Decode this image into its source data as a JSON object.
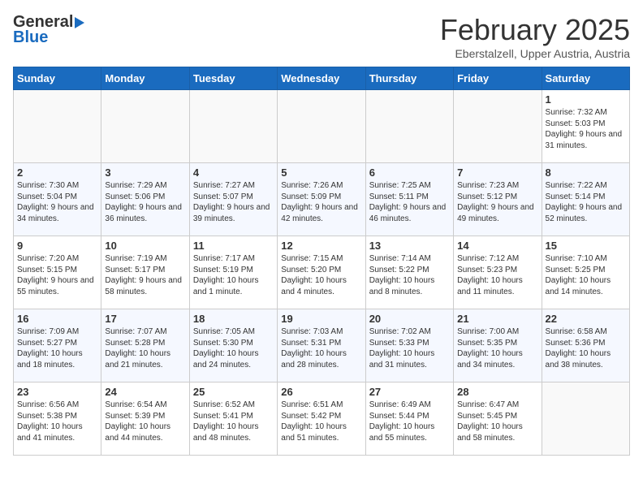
{
  "header": {
    "logo_line1_general": "General",
    "logo_line1_blue": "Blue",
    "title": "February 2025",
    "location": "Eberstalzell, Upper Austria, Austria"
  },
  "days_of_week": [
    "Sunday",
    "Monday",
    "Tuesday",
    "Wednesday",
    "Thursday",
    "Friday",
    "Saturday"
  ],
  "weeks": [
    [
      {
        "day": "",
        "info": ""
      },
      {
        "day": "",
        "info": ""
      },
      {
        "day": "",
        "info": ""
      },
      {
        "day": "",
        "info": ""
      },
      {
        "day": "",
        "info": ""
      },
      {
        "day": "",
        "info": ""
      },
      {
        "day": "1",
        "info": "Sunrise: 7:32 AM\nSunset: 5:03 PM\nDaylight: 9 hours and 31 minutes."
      }
    ],
    [
      {
        "day": "2",
        "info": "Sunrise: 7:30 AM\nSunset: 5:04 PM\nDaylight: 9 hours and 34 minutes."
      },
      {
        "day": "3",
        "info": "Sunrise: 7:29 AM\nSunset: 5:06 PM\nDaylight: 9 hours and 36 minutes."
      },
      {
        "day": "4",
        "info": "Sunrise: 7:27 AM\nSunset: 5:07 PM\nDaylight: 9 hours and 39 minutes."
      },
      {
        "day": "5",
        "info": "Sunrise: 7:26 AM\nSunset: 5:09 PM\nDaylight: 9 hours and 42 minutes."
      },
      {
        "day": "6",
        "info": "Sunrise: 7:25 AM\nSunset: 5:11 PM\nDaylight: 9 hours and 46 minutes."
      },
      {
        "day": "7",
        "info": "Sunrise: 7:23 AM\nSunset: 5:12 PM\nDaylight: 9 hours and 49 minutes."
      },
      {
        "day": "8",
        "info": "Sunrise: 7:22 AM\nSunset: 5:14 PM\nDaylight: 9 hours and 52 minutes."
      }
    ],
    [
      {
        "day": "9",
        "info": "Sunrise: 7:20 AM\nSunset: 5:15 PM\nDaylight: 9 hours and 55 minutes."
      },
      {
        "day": "10",
        "info": "Sunrise: 7:19 AM\nSunset: 5:17 PM\nDaylight: 9 hours and 58 minutes."
      },
      {
        "day": "11",
        "info": "Sunrise: 7:17 AM\nSunset: 5:19 PM\nDaylight: 10 hours and 1 minute."
      },
      {
        "day": "12",
        "info": "Sunrise: 7:15 AM\nSunset: 5:20 PM\nDaylight: 10 hours and 4 minutes."
      },
      {
        "day": "13",
        "info": "Sunrise: 7:14 AM\nSunset: 5:22 PM\nDaylight: 10 hours and 8 minutes."
      },
      {
        "day": "14",
        "info": "Sunrise: 7:12 AM\nSunset: 5:23 PM\nDaylight: 10 hours and 11 minutes."
      },
      {
        "day": "15",
        "info": "Sunrise: 7:10 AM\nSunset: 5:25 PM\nDaylight: 10 hours and 14 minutes."
      }
    ],
    [
      {
        "day": "16",
        "info": "Sunrise: 7:09 AM\nSunset: 5:27 PM\nDaylight: 10 hours and 18 minutes."
      },
      {
        "day": "17",
        "info": "Sunrise: 7:07 AM\nSunset: 5:28 PM\nDaylight: 10 hours and 21 minutes."
      },
      {
        "day": "18",
        "info": "Sunrise: 7:05 AM\nSunset: 5:30 PM\nDaylight: 10 hours and 24 minutes."
      },
      {
        "day": "19",
        "info": "Sunrise: 7:03 AM\nSunset: 5:31 PM\nDaylight: 10 hours and 28 minutes."
      },
      {
        "day": "20",
        "info": "Sunrise: 7:02 AM\nSunset: 5:33 PM\nDaylight: 10 hours and 31 minutes."
      },
      {
        "day": "21",
        "info": "Sunrise: 7:00 AM\nSunset: 5:35 PM\nDaylight: 10 hours and 34 minutes."
      },
      {
        "day": "22",
        "info": "Sunrise: 6:58 AM\nSunset: 5:36 PM\nDaylight: 10 hours and 38 minutes."
      }
    ],
    [
      {
        "day": "23",
        "info": "Sunrise: 6:56 AM\nSunset: 5:38 PM\nDaylight: 10 hours and 41 minutes."
      },
      {
        "day": "24",
        "info": "Sunrise: 6:54 AM\nSunset: 5:39 PM\nDaylight: 10 hours and 44 minutes."
      },
      {
        "day": "25",
        "info": "Sunrise: 6:52 AM\nSunset: 5:41 PM\nDaylight: 10 hours and 48 minutes."
      },
      {
        "day": "26",
        "info": "Sunrise: 6:51 AM\nSunset: 5:42 PM\nDaylight: 10 hours and 51 minutes."
      },
      {
        "day": "27",
        "info": "Sunrise: 6:49 AM\nSunset: 5:44 PM\nDaylight: 10 hours and 55 minutes."
      },
      {
        "day": "28",
        "info": "Sunrise: 6:47 AM\nSunset: 5:45 PM\nDaylight: 10 hours and 58 minutes."
      },
      {
        "day": "",
        "info": ""
      }
    ]
  ]
}
